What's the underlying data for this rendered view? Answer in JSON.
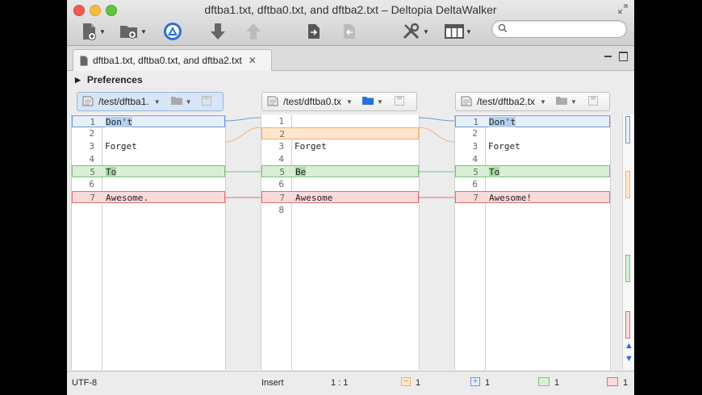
{
  "window": {
    "title": "dftba1.txt, dftba0.txt, and dftba2.txt – Deltopia DeltaWalker"
  },
  "toolbar": {
    "search_placeholder": "",
    "icons": [
      "new-document-icon",
      "new-folder-icon",
      "deltawalker-logo-icon",
      "next-diff-icon",
      "previous-diff-icon",
      "copy-to-right-icon",
      "copy-to-left-icon",
      "tools-icon",
      "layout-icon"
    ]
  },
  "tab": {
    "label": "dftba1.txt, dftba0.txt, and dftba2.txt",
    "close": "✕"
  },
  "preferences": {
    "label": "Preferences"
  },
  "panes": [
    {
      "path": "/test/dftba1.",
      "lines": [
        {
          "num": "1",
          "text": "Don't",
          "state": "changed"
        },
        {
          "num": "2",
          "text": "",
          "state": "none"
        },
        {
          "num": "3",
          "text": "Forget",
          "state": "none"
        },
        {
          "num": "4",
          "text": "",
          "state": "none"
        },
        {
          "num": "5",
          "text": "To",
          "state": "added"
        },
        {
          "num": "6",
          "text": "",
          "state": "none"
        },
        {
          "num": "7",
          "text": "Awesome.",
          "state": "removed"
        }
      ]
    },
    {
      "path": "/test/dftba0.tx",
      "lines": [
        {
          "num": "1",
          "text": "",
          "state": "none"
        },
        {
          "num": "2",
          "text": "",
          "state": "conflict"
        },
        {
          "num": "3",
          "text": "Forget",
          "state": "none"
        },
        {
          "num": "4",
          "text": "",
          "state": "none"
        },
        {
          "num": "5",
          "text": "Be",
          "state": "added"
        },
        {
          "num": "6",
          "text": "",
          "state": "none"
        },
        {
          "num": "7",
          "text": "Awesome",
          "state": "removed"
        },
        {
          "num": "8",
          "text": "",
          "state": "none"
        }
      ]
    },
    {
      "path": "/test/dftba2.tx",
      "lines": [
        {
          "num": "1",
          "text": "Don't",
          "state": "changed"
        },
        {
          "num": "2",
          "text": "",
          "state": "none"
        },
        {
          "num": "3",
          "text": "Forget",
          "state": "none"
        },
        {
          "num": "4",
          "text": "",
          "state": "none"
        },
        {
          "num": "5",
          "text": "To",
          "state": "added"
        },
        {
          "num": "6",
          "text": "",
          "state": "none"
        },
        {
          "num": "7",
          "text": "Awesome!",
          "state": "removed"
        }
      ]
    }
  ],
  "status": {
    "encoding": "UTF-8",
    "mode": "Insert",
    "position": "1 : 1",
    "conflict_count": "1",
    "changed_count": "1",
    "added_count": "1",
    "removed_count": "1"
  },
  "colors": {
    "changed": "#6e98d3",
    "conflict": "#f0b070",
    "added": "#7ec27a",
    "removed": "#e07070",
    "accent": "#2c6fd6"
  }
}
